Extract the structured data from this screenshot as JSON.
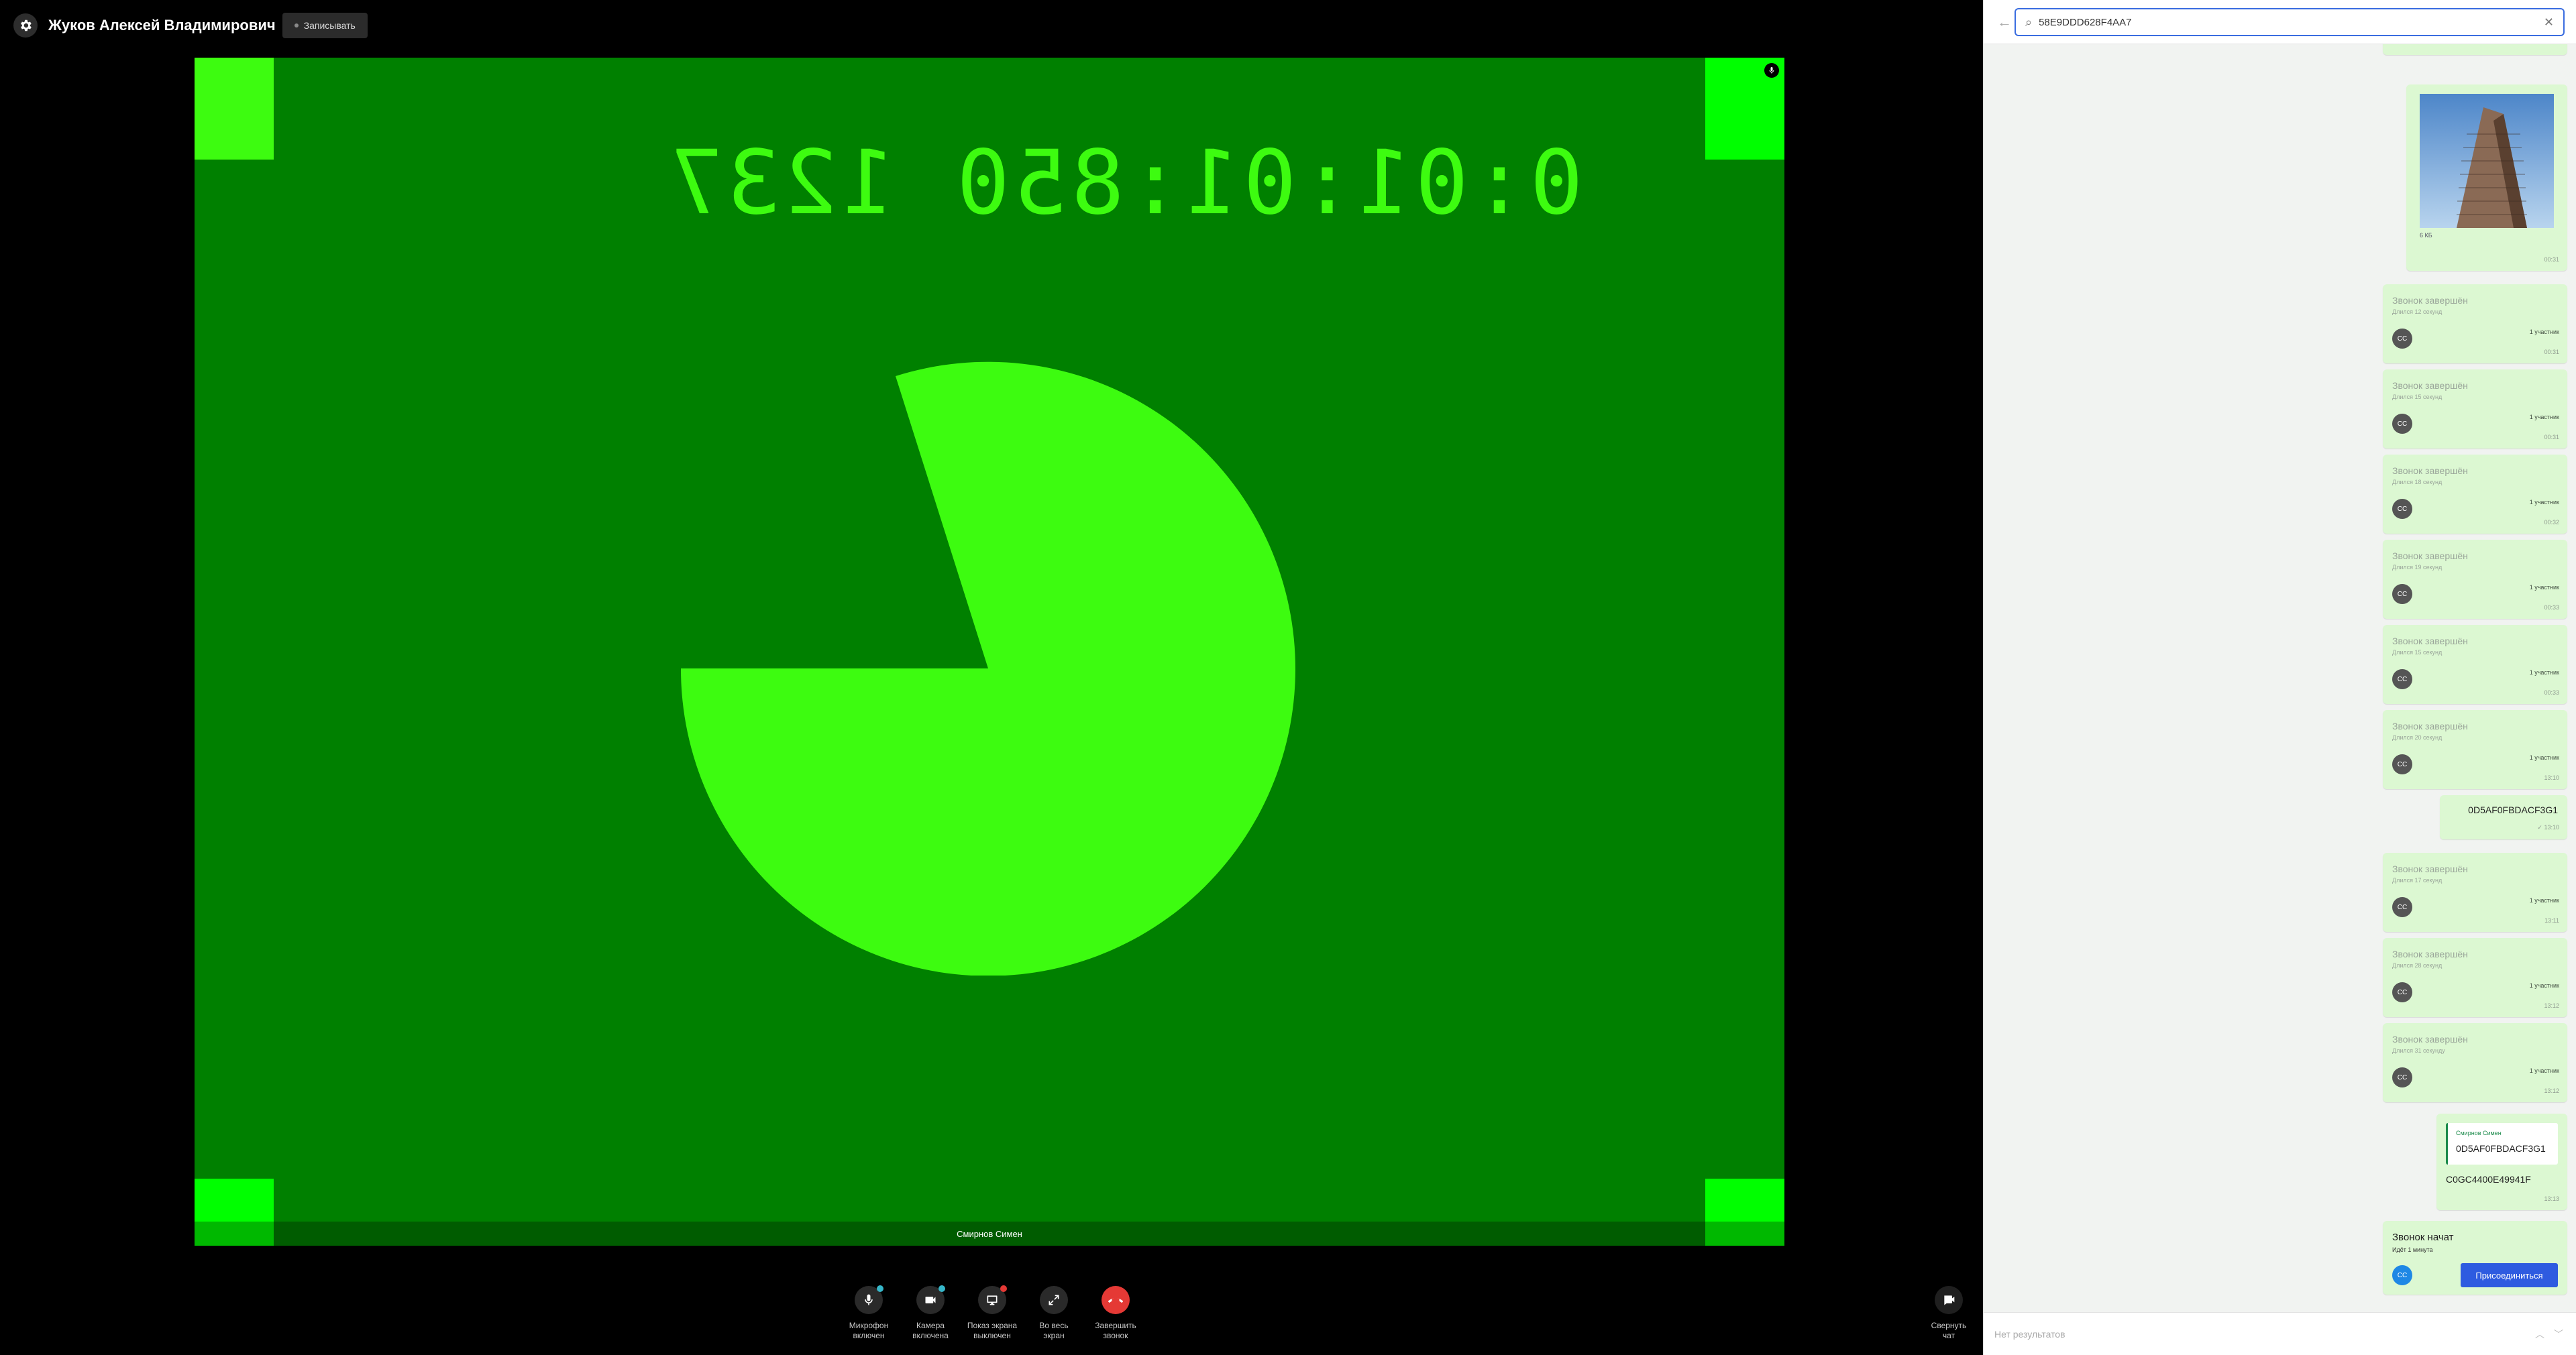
{
  "header": {
    "caller_name": "Жуков Алексей Владимирович",
    "record_label": "Записывать"
  },
  "video": {
    "timecode": "0:01:01:850 1237",
    "participant_name": "Смирнов Симен"
  },
  "controls": [
    {
      "name": "mic-toggle",
      "icon": "microphone-icon",
      "line1": "Микрофон",
      "line2": "включен",
      "dot": "#36b6c9"
    },
    {
      "name": "camera-toggle",
      "icon": "camera-icon",
      "line1": "Камера",
      "line2": "включена",
      "dot": "#36b6c9"
    },
    {
      "name": "screen-share-toggle",
      "icon": "screen-share-icon",
      "line1": "Показ экрана",
      "line2": "выключен",
      "dot": "#e53935"
    },
    {
      "name": "fullscreen-toggle",
      "icon": "fullscreen-icon",
      "line1": "Во весь",
      "line2": "экран",
      "dot": ""
    },
    {
      "name": "end-call",
      "icon": "phone-hangup-icon",
      "line1": "Завершить",
      "line2": "звонок",
      "dot": ""
    }
  ],
  "collapse_chat": {
    "line1": "Свернуть",
    "line2": "чат"
  },
  "search": {
    "query": "58E9DDD628F4AA7"
  },
  "photo_message": {
    "size": "6 КБ",
    "time": "00:31"
  },
  "call_cards": [
    {
      "title": "Звонок завершён",
      "duration": "Длился 12 секунд",
      "avatar": "CC",
      "participants": "1 участник",
      "time": "00:31"
    },
    {
      "title": "Звонок завершён",
      "duration": "Длился 15 секунд",
      "avatar": "CC",
      "participants": "1 участник",
      "time": "00:31"
    },
    {
      "title": "Звонок завершён",
      "duration": "Длился 18 секунд",
      "avatar": "CC",
      "participants": "1 участник",
      "time": "00:32"
    },
    {
      "title": "Звонок завершён",
      "duration": "Длился 19 секунд",
      "avatar": "CC",
      "participants": "1 участник",
      "time": "00:33"
    },
    {
      "title": "Звонок завершён",
      "duration": "Длился 15 секунд",
      "avatar": "CC",
      "participants": "1 участник",
      "time": "00:33"
    },
    {
      "title": "Звонок завершён",
      "duration": "Длился 20 секунд",
      "avatar": "CC",
      "participants": "1 участник",
      "time": "13:10"
    }
  ],
  "text_message": {
    "text": "0D5AF0FBDACF3G1",
    "time": "13:10"
  },
  "call_cards_2": [
    {
      "title": "Звонок завершён",
      "duration": "Длился 17 секунд",
      "avatar": "CC",
      "participants": "1 участник",
      "time": "13:11"
    },
    {
      "title": "Звонок завершён",
      "duration": "Длился 28 секунд",
      "avatar": "CC",
      "participants": "1 участник",
      "time": "13:12"
    },
    {
      "title": "Звонок завершён",
      "duration": "Длился 31 секунду",
      "avatar": "CC",
      "participants": "1 участник",
      "time": "13:12"
    }
  ],
  "reply_message": {
    "quote_author": "Смирнов Симен",
    "quote_text": "0D5AF0FBDACF3G1",
    "text": "C0GC4400E49941F",
    "time": "13:13"
  },
  "active_call": {
    "title": "Звонок начат",
    "status": "Идёт 1 минута",
    "avatar": "CC",
    "join_label": "Присоединиться"
  },
  "footer": {
    "no_results": "Нет результатов"
  }
}
